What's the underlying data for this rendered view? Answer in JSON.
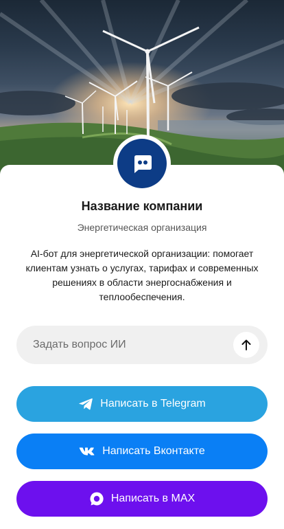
{
  "company": {
    "name": "Название компании",
    "type": "Энергетическая организация",
    "description": "AI-бот для энергетической организации: помогает клиентам узнать о услугах, тарифах и современных решениях в области энергоснабжения и теплообеспечения."
  },
  "ask": {
    "placeholder": "Задать вопрос ИИ"
  },
  "buttons": {
    "telegram": "Написать в Telegram",
    "vk": "Написать Вконтакте",
    "max": "Написать в MAX"
  },
  "colors": {
    "avatar_bg": "#0d3c86",
    "telegram": "#2aa3e0",
    "vk": "#0a7ff5",
    "max": "#6d10ee"
  }
}
